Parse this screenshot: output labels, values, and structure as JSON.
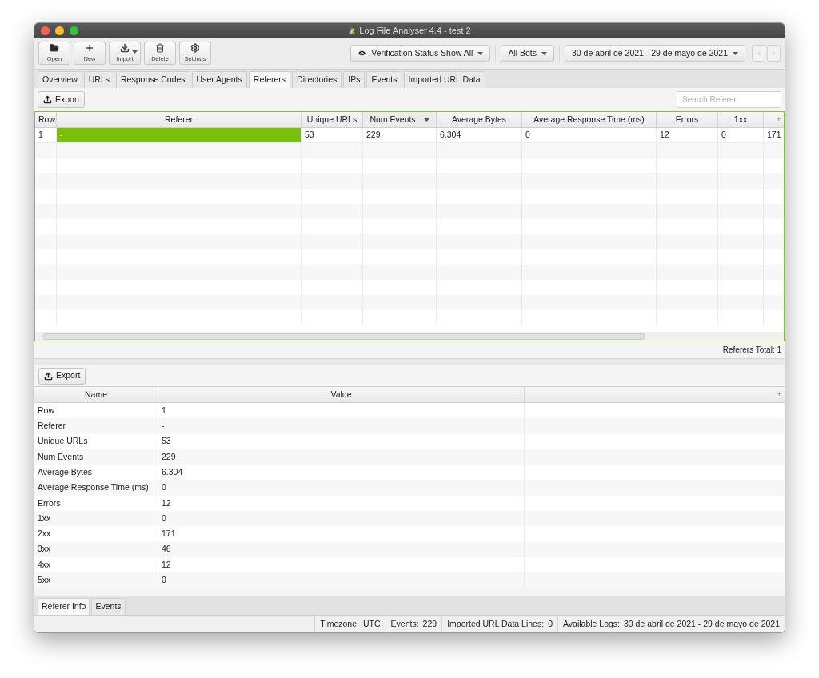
{
  "window": {
    "title": "Log File Analyser 4.4 - test 2"
  },
  "toolbar": {
    "buttons": [
      {
        "kind": "open",
        "label": "Open",
        "menu": false
      },
      {
        "kind": "new",
        "label": "New",
        "menu": false
      },
      {
        "kind": "import",
        "label": "Import",
        "menu": true
      },
      {
        "kind": "delete",
        "label": "Delete",
        "menu": false
      },
      {
        "kind": "settings",
        "label": "Settings",
        "menu": false
      }
    ],
    "filters": [
      {
        "kind": "verification",
        "label": "Verification Status Show All"
      },
      {
        "kind": "plain",
        "label": "All Bots"
      },
      {
        "kind": "plain",
        "label": "30 de abril de 2021 - 29 de mayo de 2021"
      }
    ],
    "nav": [
      {
        "kind": "prev",
        "disabled": true
      },
      {
        "kind": "next",
        "disabled": true
      }
    ]
  },
  "tabs": [
    {
      "label": "Overview",
      "selected": false
    },
    {
      "label": "URLs",
      "selected": false
    },
    {
      "label": "Response Codes",
      "selected": false
    },
    {
      "label": "User Agents",
      "selected": false
    },
    {
      "label": "Referers",
      "selected": true
    },
    {
      "label": "Directories",
      "selected": false
    },
    {
      "label": "IPs",
      "selected": false
    },
    {
      "label": "Events",
      "selected": false
    },
    {
      "label": "Imported URL Data",
      "selected": false
    }
  ],
  "export_button": "Export",
  "search": {
    "placeholder": "Search Referer"
  },
  "table": {
    "columns": [
      {
        "label": "Row",
        "sorted": false
      },
      {
        "label": "Referer",
        "sorted": false
      },
      {
        "label": "Unique URLs",
        "sorted": false
      },
      {
        "label": "Num Events",
        "sorted": true
      },
      {
        "label": "Average Bytes",
        "sorted": false
      },
      {
        "label": "Average Response Time (ms)",
        "sorted": false
      },
      {
        "label": "Errors",
        "sorted": false
      },
      {
        "label": "1xx",
        "sorted": false
      }
    ],
    "column_menu": "+",
    "rows": [
      {
        "cells": [
          {
            "text": "1",
            "selected": false
          },
          {
            "text": "-",
            "selected": true
          },
          {
            "text": "53",
            "selected": false
          },
          {
            "text": "229",
            "selected": false
          },
          {
            "text": "6.304",
            "selected": false
          },
          {
            "text": "0",
            "selected": false
          },
          {
            "text": "12",
            "selected": false
          },
          {
            "text": "0",
            "selected": false
          },
          {
            "text": "171",
            "selected": false
          }
        ]
      }
    ]
  },
  "total": "Referers Total: 1",
  "details": {
    "export_button": "Export",
    "columns": [
      "Name",
      "Value"
    ],
    "column_menu": "+",
    "rows": [
      {
        "name": "Row",
        "value": "1"
      },
      {
        "name": "Referer",
        "value": "-"
      },
      {
        "name": "Unique URLs",
        "value": "53"
      },
      {
        "name": "Num Events",
        "value": "229"
      },
      {
        "name": "Average Bytes",
        "value": "6.304"
      },
      {
        "name": "Average Response Time (ms)",
        "value": "0"
      },
      {
        "name": "Errors",
        "value": "12"
      },
      {
        "name": "1xx",
        "value": "0"
      },
      {
        "name": "2xx",
        "value": "171"
      },
      {
        "name": "3xx",
        "value": "46"
      },
      {
        "name": "4xx",
        "value": "12"
      },
      {
        "name": "5xx",
        "value": "0"
      }
    ]
  },
  "bottom_tabs": [
    {
      "label": "Referer Info",
      "selected": true
    },
    {
      "label": "Events",
      "selected": false
    }
  ],
  "status_bar": [
    {
      "label": "Timezone:",
      "value": "UTC"
    },
    {
      "label": "Events:",
      "value": "229"
    },
    {
      "label": "Imported URL Data Lines:",
      "value": "0"
    },
    {
      "label": "Available Logs:",
      "value": "30 de abril de 2021 - 29 de mayo de 2021"
    }
  ]
}
